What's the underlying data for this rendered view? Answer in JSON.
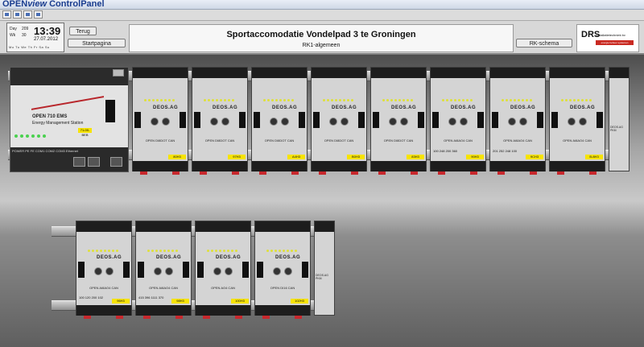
{
  "window": {
    "title_prefix": "OPEN",
    "title_italic": "view",
    "title_suffix": " ControlPanel"
  },
  "toolbar": {
    "icons": [
      "save-icon",
      "print-icon",
      "image-icon",
      "globe-icon"
    ]
  },
  "clock": {
    "time": "13:39",
    "date": "27.07.2012",
    "day_label": "Day",
    "day_value": "209",
    "wk_label": "Wk",
    "wk_value": "30",
    "days": "Mo Tu We Th Fr Sa Su"
  },
  "header": {
    "back_button": "Terug",
    "start_button": "Startpagina",
    "title": "Sportaccomodatie Vondelpad 3 te Groningen",
    "subtitle": "RK1-algemeen",
    "schema_button": "RK-schema"
  },
  "logo": {
    "name": "DRS",
    "tagline": "installatietechniek bv",
    "bar_text": "energie beheer systemen"
  },
  "controller": {
    "brand": "OPEN 710 EMS",
    "subtitle": "Energy Management Station",
    "ports": "POWER   PE   FE   COM1  COM2   COM3  Ethernet",
    "tag": "71-00-BEB",
    "can": "CAN"
  },
  "modules_row1": [
    {
      "brand": "DEOS.AG",
      "name": "OPEN DI8DOT CAN",
      "tag": "80H3"
    },
    {
      "brand": "DEOS.AG",
      "name": "OPEN DI8DOT CAN",
      "tag": "97H3"
    },
    {
      "brand": "DEOS.AG",
      "name": "OPEN DI8DOT CAN",
      "tag": "A4H3"
    },
    {
      "brand": "DEOS.AG",
      "name": "OPEN DI8DOT CAN",
      "tag": "B0H3"
    },
    {
      "brand": "DEOS.AG",
      "name": "OPEN DI8DOT CAN",
      "tag": "83H3"
    },
    {
      "brand": "DEOS.AG",
      "name": "OPEN AI8AO4 CAN",
      "tag": "90H3",
      "vals": "100 248 200 360"
    },
    {
      "brand": "DEOS.AG",
      "name": "OPEN AI8AO4 CAN",
      "tag": "9CH3",
      "vals": "201 252 248 100"
    },
    {
      "brand": "DEOS.AG",
      "name": "OPEN AI8AO4 CAN",
      "tag": "B-8H3",
      "vals": ""
    }
  ],
  "pwr_row1": {
    "text": "DEOS.AG PKM"
  },
  "modules_row2": [
    {
      "brand": "DEOS.AG",
      "name": "OPEN AI8AO4 CAN",
      "tag": "96H3",
      "vals": "100 120 200 102"
    },
    {
      "brand": "DEOS.AG",
      "name": "OPEN AI8AO4 CAN",
      "tag": "98H3",
      "vals": "415 396 1111 370"
    },
    {
      "brand": "DEOS.AG",
      "name": "OPEN AO4 CAN",
      "tag": "100H3",
      "vals": ""
    },
    {
      "brand": "DEOS.AG",
      "name": "OPEN DI16 CAN",
      "tag": "102H3",
      "vals": ""
    }
  ],
  "pwr_row2": {
    "text": "DEOS.AG PKM"
  }
}
